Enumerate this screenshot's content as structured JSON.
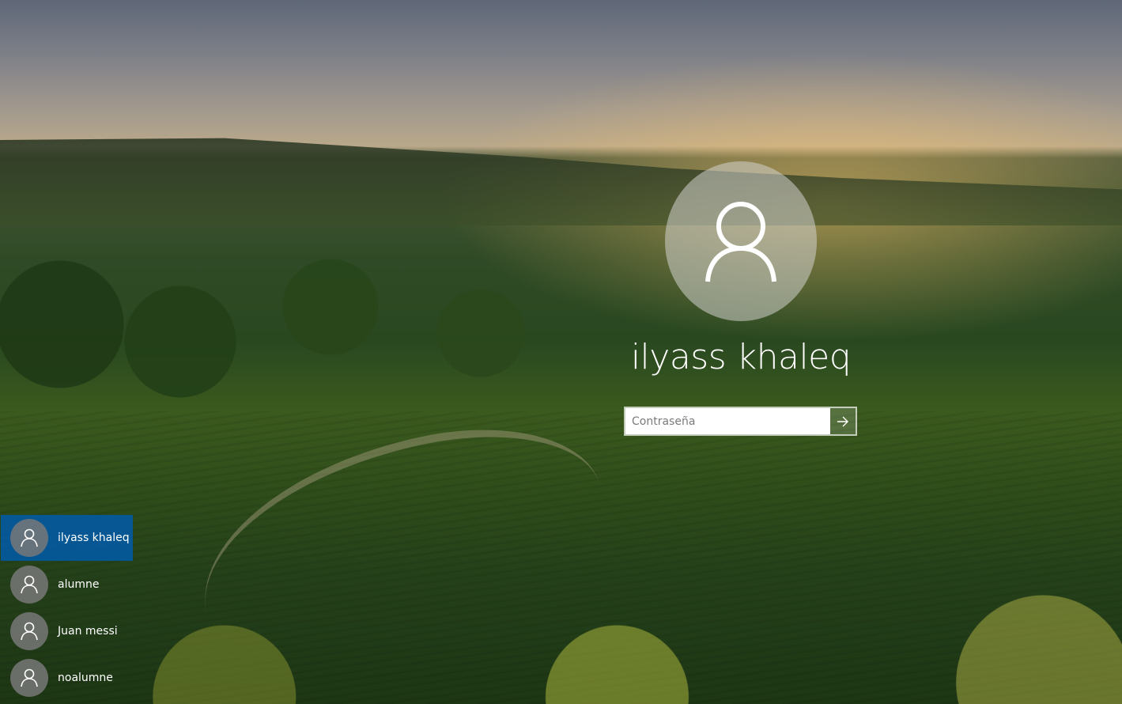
{
  "login": {
    "username": "ilyass khaleq",
    "password_placeholder": "Contraseña",
    "avatar_icon": "user-icon",
    "submit_icon": "arrow-right-icon"
  },
  "user_list": {
    "selected_color": "#005aaa",
    "items": [
      {
        "name": "ilyass khaleq",
        "selected": true
      },
      {
        "name": "alumne",
        "selected": false
      },
      {
        "name": "Juan messi",
        "selected": false
      },
      {
        "name": "noalumne",
        "selected": false
      }
    ]
  }
}
